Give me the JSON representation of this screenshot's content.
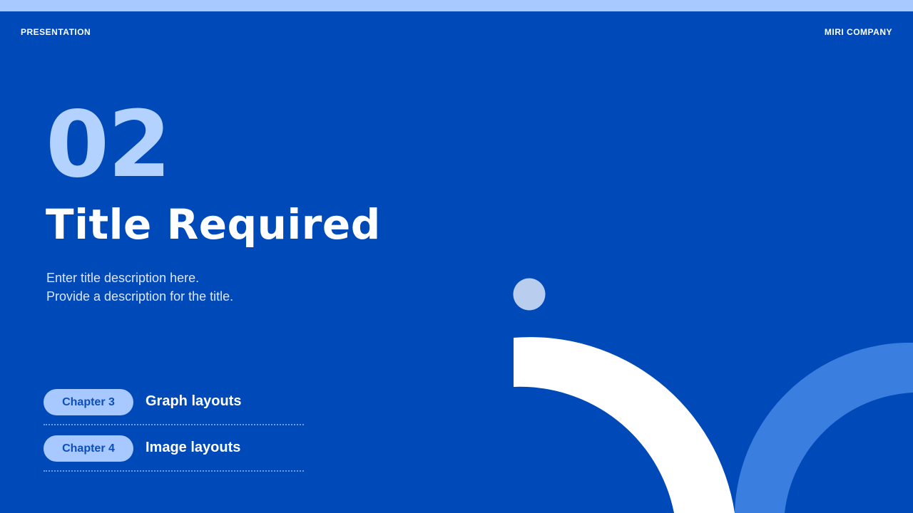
{
  "header": {
    "left": "PRESENTATION",
    "right": "MIRI COMPANY"
  },
  "section": {
    "number": "02",
    "title": "Title Required",
    "description": [
      "Enter title description here.",
      "Provide a description for the title."
    ]
  },
  "chapters": [
    {
      "pill": "Chapter 3",
      "label": "Graph layouts"
    },
    {
      "pill": "Chapter 4",
      "label": "Image layouts"
    }
  ],
  "colors": {
    "background": "#0049b8",
    "accent_light": "#a8c9ff",
    "arc_white": "#ffffff",
    "arc_blue": "#3a7ee0",
    "dot": "#b9cdee"
  }
}
